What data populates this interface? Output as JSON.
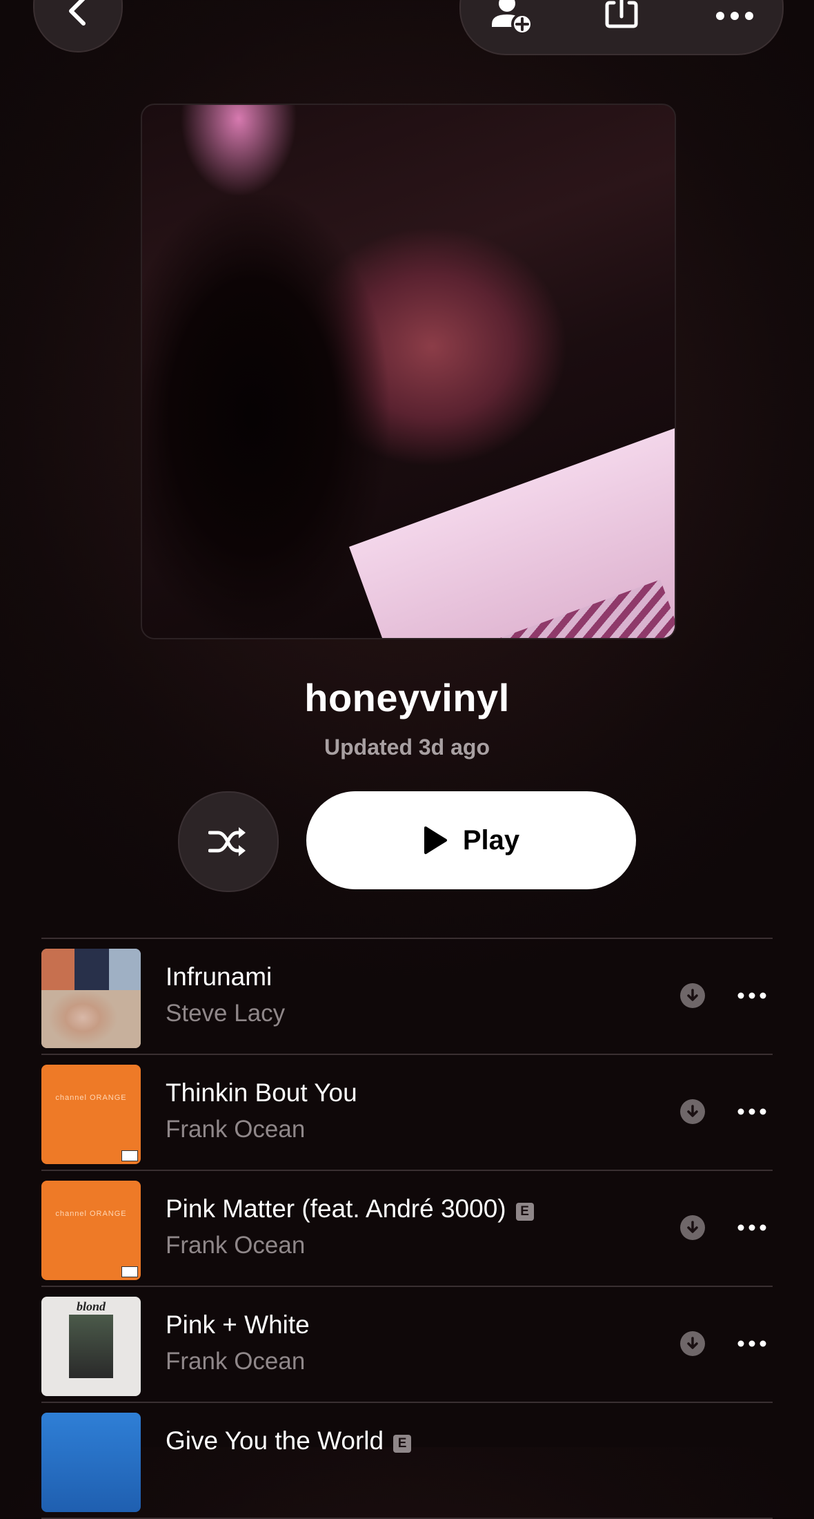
{
  "header": {
    "back_icon": "chevron-left-icon",
    "actions": [
      {
        "name": "add-collaborator",
        "icon": "person-add-icon"
      },
      {
        "name": "share",
        "icon": "share-icon"
      },
      {
        "name": "more",
        "icon": "ellipsis-icon"
      }
    ]
  },
  "playlist": {
    "title": "honeyvinyl",
    "updated": "Updated 3d ago"
  },
  "controls": {
    "shuffle_icon": "shuffle-icon",
    "play_label": "Play"
  },
  "tracks": [
    {
      "title": "Infrunami",
      "artist": "Steve Lacy",
      "explicit": false
    },
    {
      "title": "Thinkin Bout You",
      "artist": "Frank Ocean",
      "explicit": false,
      "art_text": "channel ORANGE"
    },
    {
      "title": "Pink Matter (feat. André 3000)",
      "artist": "Frank Ocean",
      "explicit": true,
      "art_text": "channel ORANGE"
    },
    {
      "title": "Pink + White",
      "artist": "Frank Ocean",
      "explicit": false,
      "art_text": "blond"
    },
    {
      "title": "Give You the World",
      "artist": "",
      "explicit": true
    }
  ],
  "explicit_badge": "E",
  "colors": {
    "accent": "#ffffff",
    "background": "#130a0b",
    "secondary_text": "#8f8789",
    "orange_art": "#ee7a27"
  }
}
